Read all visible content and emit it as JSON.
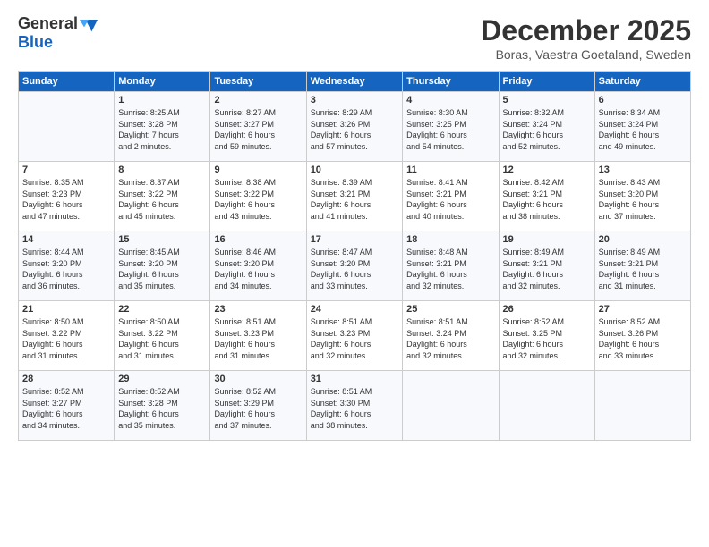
{
  "header": {
    "logo_general": "General",
    "logo_blue": "Blue",
    "title": "December 2025",
    "location": "Boras, Vaestra Goetaland, Sweden"
  },
  "days_of_week": [
    "Sunday",
    "Monday",
    "Tuesday",
    "Wednesday",
    "Thursday",
    "Friday",
    "Saturday"
  ],
  "weeks": [
    [
      {
        "day": "",
        "info": ""
      },
      {
        "day": "1",
        "info": "Sunrise: 8:25 AM\nSunset: 3:28 PM\nDaylight: 7 hours\nand 2 minutes."
      },
      {
        "day": "2",
        "info": "Sunrise: 8:27 AM\nSunset: 3:27 PM\nDaylight: 6 hours\nand 59 minutes."
      },
      {
        "day": "3",
        "info": "Sunrise: 8:29 AM\nSunset: 3:26 PM\nDaylight: 6 hours\nand 57 minutes."
      },
      {
        "day": "4",
        "info": "Sunrise: 8:30 AM\nSunset: 3:25 PM\nDaylight: 6 hours\nand 54 minutes."
      },
      {
        "day": "5",
        "info": "Sunrise: 8:32 AM\nSunset: 3:24 PM\nDaylight: 6 hours\nand 52 minutes."
      },
      {
        "day": "6",
        "info": "Sunrise: 8:34 AM\nSunset: 3:24 PM\nDaylight: 6 hours\nand 49 minutes."
      }
    ],
    [
      {
        "day": "7",
        "info": "Sunrise: 8:35 AM\nSunset: 3:23 PM\nDaylight: 6 hours\nand 47 minutes."
      },
      {
        "day": "8",
        "info": "Sunrise: 8:37 AM\nSunset: 3:22 PM\nDaylight: 6 hours\nand 45 minutes."
      },
      {
        "day": "9",
        "info": "Sunrise: 8:38 AM\nSunset: 3:22 PM\nDaylight: 6 hours\nand 43 minutes."
      },
      {
        "day": "10",
        "info": "Sunrise: 8:39 AM\nSunset: 3:21 PM\nDaylight: 6 hours\nand 41 minutes."
      },
      {
        "day": "11",
        "info": "Sunrise: 8:41 AM\nSunset: 3:21 PM\nDaylight: 6 hours\nand 40 minutes."
      },
      {
        "day": "12",
        "info": "Sunrise: 8:42 AM\nSunset: 3:21 PM\nDaylight: 6 hours\nand 38 minutes."
      },
      {
        "day": "13",
        "info": "Sunrise: 8:43 AM\nSunset: 3:20 PM\nDaylight: 6 hours\nand 37 minutes."
      }
    ],
    [
      {
        "day": "14",
        "info": "Sunrise: 8:44 AM\nSunset: 3:20 PM\nDaylight: 6 hours\nand 36 minutes."
      },
      {
        "day": "15",
        "info": "Sunrise: 8:45 AM\nSunset: 3:20 PM\nDaylight: 6 hours\nand 35 minutes."
      },
      {
        "day": "16",
        "info": "Sunrise: 8:46 AM\nSunset: 3:20 PM\nDaylight: 6 hours\nand 34 minutes."
      },
      {
        "day": "17",
        "info": "Sunrise: 8:47 AM\nSunset: 3:20 PM\nDaylight: 6 hours\nand 33 minutes."
      },
      {
        "day": "18",
        "info": "Sunrise: 8:48 AM\nSunset: 3:21 PM\nDaylight: 6 hours\nand 32 minutes."
      },
      {
        "day": "19",
        "info": "Sunrise: 8:49 AM\nSunset: 3:21 PM\nDaylight: 6 hours\nand 32 minutes."
      },
      {
        "day": "20",
        "info": "Sunrise: 8:49 AM\nSunset: 3:21 PM\nDaylight: 6 hours\nand 31 minutes."
      }
    ],
    [
      {
        "day": "21",
        "info": "Sunrise: 8:50 AM\nSunset: 3:22 PM\nDaylight: 6 hours\nand 31 minutes."
      },
      {
        "day": "22",
        "info": "Sunrise: 8:50 AM\nSunset: 3:22 PM\nDaylight: 6 hours\nand 31 minutes."
      },
      {
        "day": "23",
        "info": "Sunrise: 8:51 AM\nSunset: 3:23 PM\nDaylight: 6 hours\nand 31 minutes."
      },
      {
        "day": "24",
        "info": "Sunrise: 8:51 AM\nSunset: 3:23 PM\nDaylight: 6 hours\nand 32 minutes."
      },
      {
        "day": "25",
        "info": "Sunrise: 8:51 AM\nSunset: 3:24 PM\nDaylight: 6 hours\nand 32 minutes."
      },
      {
        "day": "26",
        "info": "Sunrise: 8:52 AM\nSunset: 3:25 PM\nDaylight: 6 hours\nand 32 minutes."
      },
      {
        "day": "27",
        "info": "Sunrise: 8:52 AM\nSunset: 3:26 PM\nDaylight: 6 hours\nand 33 minutes."
      }
    ],
    [
      {
        "day": "28",
        "info": "Sunrise: 8:52 AM\nSunset: 3:27 PM\nDaylight: 6 hours\nand 34 minutes."
      },
      {
        "day": "29",
        "info": "Sunrise: 8:52 AM\nSunset: 3:28 PM\nDaylight: 6 hours\nand 35 minutes."
      },
      {
        "day": "30",
        "info": "Sunrise: 8:52 AM\nSunset: 3:29 PM\nDaylight: 6 hours\nand 37 minutes."
      },
      {
        "day": "31",
        "info": "Sunrise: 8:51 AM\nSunset: 3:30 PM\nDaylight: 6 hours\nand 38 minutes."
      },
      {
        "day": "",
        "info": ""
      },
      {
        "day": "",
        "info": ""
      },
      {
        "day": "",
        "info": ""
      }
    ]
  ]
}
